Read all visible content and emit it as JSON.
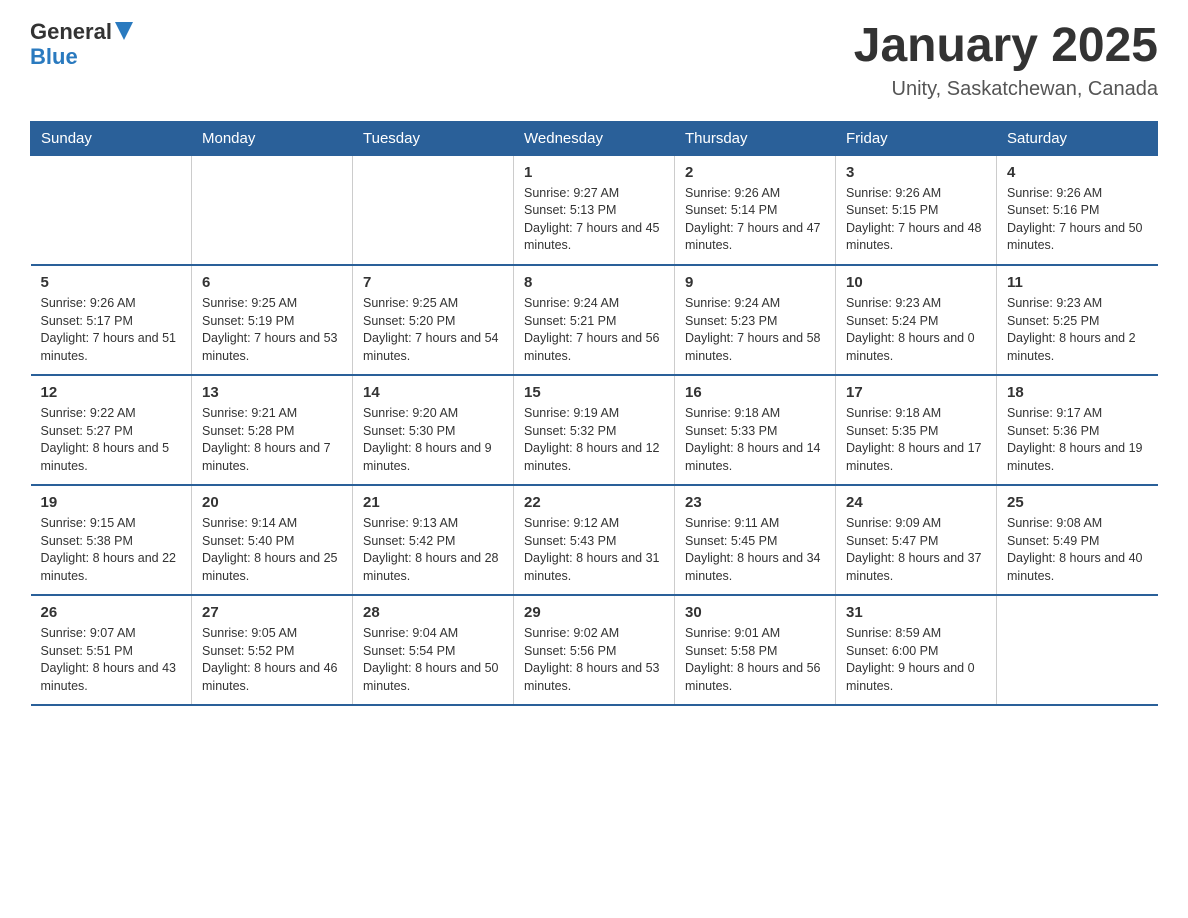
{
  "logo": {
    "general": "General",
    "blue": "Blue"
  },
  "title": "January 2025",
  "subtitle": "Unity, Saskatchewan, Canada",
  "weekdays": [
    "Sunday",
    "Monday",
    "Tuesday",
    "Wednesday",
    "Thursday",
    "Friday",
    "Saturday"
  ],
  "weeks": [
    [
      {
        "day": "",
        "info": ""
      },
      {
        "day": "",
        "info": ""
      },
      {
        "day": "",
        "info": ""
      },
      {
        "day": "1",
        "info": "Sunrise: 9:27 AM\nSunset: 5:13 PM\nDaylight: 7 hours\nand 45 minutes."
      },
      {
        "day": "2",
        "info": "Sunrise: 9:26 AM\nSunset: 5:14 PM\nDaylight: 7 hours\nand 47 minutes."
      },
      {
        "day": "3",
        "info": "Sunrise: 9:26 AM\nSunset: 5:15 PM\nDaylight: 7 hours\nand 48 minutes."
      },
      {
        "day": "4",
        "info": "Sunrise: 9:26 AM\nSunset: 5:16 PM\nDaylight: 7 hours\nand 50 minutes."
      }
    ],
    [
      {
        "day": "5",
        "info": "Sunrise: 9:26 AM\nSunset: 5:17 PM\nDaylight: 7 hours\nand 51 minutes."
      },
      {
        "day": "6",
        "info": "Sunrise: 9:25 AM\nSunset: 5:19 PM\nDaylight: 7 hours\nand 53 minutes."
      },
      {
        "day": "7",
        "info": "Sunrise: 9:25 AM\nSunset: 5:20 PM\nDaylight: 7 hours\nand 54 minutes."
      },
      {
        "day": "8",
        "info": "Sunrise: 9:24 AM\nSunset: 5:21 PM\nDaylight: 7 hours\nand 56 minutes."
      },
      {
        "day": "9",
        "info": "Sunrise: 9:24 AM\nSunset: 5:23 PM\nDaylight: 7 hours\nand 58 minutes."
      },
      {
        "day": "10",
        "info": "Sunrise: 9:23 AM\nSunset: 5:24 PM\nDaylight: 8 hours\nand 0 minutes."
      },
      {
        "day": "11",
        "info": "Sunrise: 9:23 AM\nSunset: 5:25 PM\nDaylight: 8 hours\nand 2 minutes."
      }
    ],
    [
      {
        "day": "12",
        "info": "Sunrise: 9:22 AM\nSunset: 5:27 PM\nDaylight: 8 hours\nand 5 minutes."
      },
      {
        "day": "13",
        "info": "Sunrise: 9:21 AM\nSunset: 5:28 PM\nDaylight: 8 hours\nand 7 minutes."
      },
      {
        "day": "14",
        "info": "Sunrise: 9:20 AM\nSunset: 5:30 PM\nDaylight: 8 hours\nand 9 minutes."
      },
      {
        "day": "15",
        "info": "Sunrise: 9:19 AM\nSunset: 5:32 PM\nDaylight: 8 hours\nand 12 minutes."
      },
      {
        "day": "16",
        "info": "Sunrise: 9:18 AM\nSunset: 5:33 PM\nDaylight: 8 hours\nand 14 minutes."
      },
      {
        "day": "17",
        "info": "Sunrise: 9:18 AM\nSunset: 5:35 PM\nDaylight: 8 hours\nand 17 minutes."
      },
      {
        "day": "18",
        "info": "Sunrise: 9:17 AM\nSunset: 5:36 PM\nDaylight: 8 hours\nand 19 minutes."
      }
    ],
    [
      {
        "day": "19",
        "info": "Sunrise: 9:15 AM\nSunset: 5:38 PM\nDaylight: 8 hours\nand 22 minutes."
      },
      {
        "day": "20",
        "info": "Sunrise: 9:14 AM\nSunset: 5:40 PM\nDaylight: 8 hours\nand 25 minutes."
      },
      {
        "day": "21",
        "info": "Sunrise: 9:13 AM\nSunset: 5:42 PM\nDaylight: 8 hours\nand 28 minutes."
      },
      {
        "day": "22",
        "info": "Sunrise: 9:12 AM\nSunset: 5:43 PM\nDaylight: 8 hours\nand 31 minutes."
      },
      {
        "day": "23",
        "info": "Sunrise: 9:11 AM\nSunset: 5:45 PM\nDaylight: 8 hours\nand 34 minutes."
      },
      {
        "day": "24",
        "info": "Sunrise: 9:09 AM\nSunset: 5:47 PM\nDaylight: 8 hours\nand 37 minutes."
      },
      {
        "day": "25",
        "info": "Sunrise: 9:08 AM\nSunset: 5:49 PM\nDaylight: 8 hours\nand 40 minutes."
      }
    ],
    [
      {
        "day": "26",
        "info": "Sunrise: 9:07 AM\nSunset: 5:51 PM\nDaylight: 8 hours\nand 43 minutes."
      },
      {
        "day": "27",
        "info": "Sunrise: 9:05 AM\nSunset: 5:52 PM\nDaylight: 8 hours\nand 46 minutes."
      },
      {
        "day": "28",
        "info": "Sunrise: 9:04 AM\nSunset: 5:54 PM\nDaylight: 8 hours\nand 50 minutes."
      },
      {
        "day": "29",
        "info": "Sunrise: 9:02 AM\nSunset: 5:56 PM\nDaylight: 8 hours\nand 53 minutes."
      },
      {
        "day": "30",
        "info": "Sunrise: 9:01 AM\nSunset: 5:58 PM\nDaylight: 8 hours\nand 56 minutes."
      },
      {
        "day": "31",
        "info": "Sunrise: 8:59 AM\nSunset: 6:00 PM\nDaylight: 9 hours\nand 0 minutes."
      },
      {
        "day": "",
        "info": ""
      }
    ]
  ]
}
